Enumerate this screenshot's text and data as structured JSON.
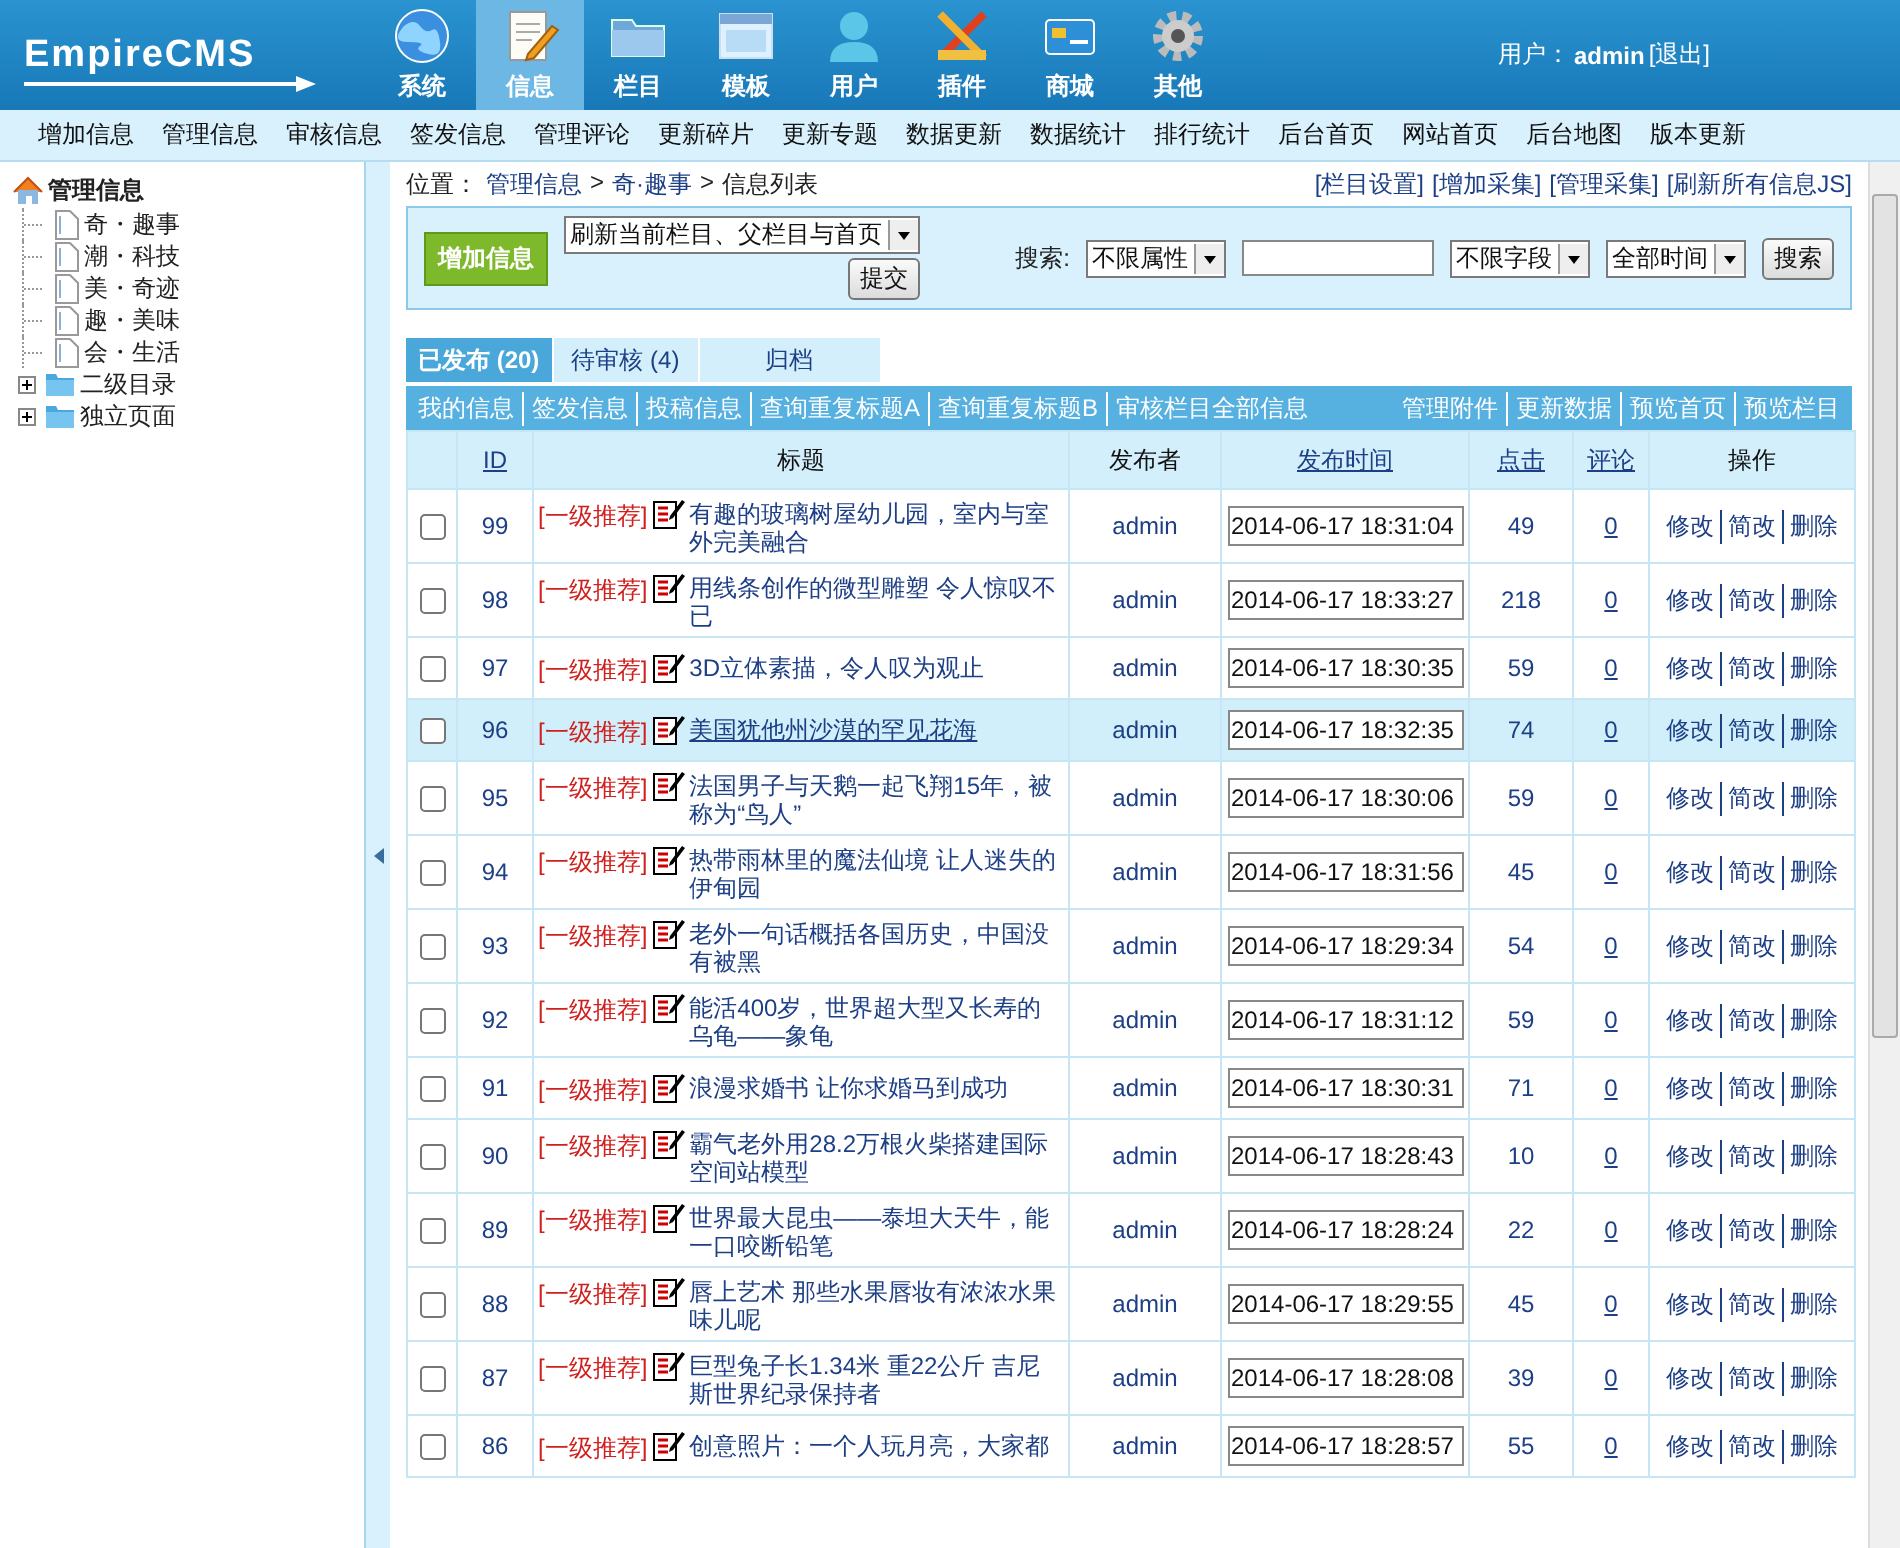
{
  "logo": {
    "text": "EmpireCMS"
  },
  "top_menu": [
    {
      "label": "系统",
      "selected": false
    },
    {
      "label": "信息",
      "selected": true
    },
    {
      "label": "栏目",
      "selected": false
    },
    {
      "label": "模板",
      "selected": false
    },
    {
      "label": "用户",
      "selected": false
    },
    {
      "label": "插件",
      "selected": false
    },
    {
      "label": "商城",
      "selected": false
    },
    {
      "label": "其他",
      "selected": false
    }
  ],
  "user": {
    "label": "用户：",
    "name": "admin",
    "logout": "[退出]"
  },
  "sub_menu": [
    "增加信息",
    "管理信息",
    "审核信息",
    "签发信息",
    "管理评论",
    "更新碎片",
    "更新专题",
    "数据更新",
    "数据统计",
    "排行统计",
    "后台首页",
    "网站首页",
    "后台地图",
    "版本更新"
  ],
  "tree": {
    "label": "管理信息",
    "children": [
      {
        "label": "奇・趣事",
        "kind": "page"
      },
      {
        "label": "潮・科技",
        "kind": "page"
      },
      {
        "label": "美・奇迹",
        "kind": "page"
      },
      {
        "label": "趣・美味",
        "kind": "page"
      },
      {
        "label": "会・生活",
        "kind": "page"
      },
      {
        "label": "二级目录",
        "kind": "folder",
        "expanded": false
      },
      {
        "label": "独立页面",
        "kind": "folder",
        "expanded": false
      }
    ]
  },
  "breadcrumb": {
    "label": "位置：",
    "separator": ">",
    "path": [
      "管理信息",
      "奇·趣事",
      "信息列表"
    ]
  },
  "quick_links": [
    "[栏目设置]",
    "[增加采集]",
    "[管理采集]",
    "[刷新所有信息JS]"
  ],
  "toolbar": {
    "add_button": "增加信息",
    "refresh_select": "刷新当前栏目、父栏目与首页",
    "submit_button": "提交",
    "search_label": "搜索:",
    "attribute_select": "不限属性",
    "field_select": "不限字段",
    "time_select": "全部时间",
    "search_button": "搜索"
  },
  "tabs": [
    {
      "label": "已发布 (20)",
      "selected": true
    },
    {
      "label": "待审核 (4)",
      "selected": false
    },
    {
      "label": "归档",
      "selected": false
    }
  ],
  "links_left": [
    "我的信息",
    "签发信息",
    "投稿信息",
    "查询重复标题A",
    "查询重复标题B",
    "审核栏目全部信息"
  ],
  "links_right": [
    "管理附件",
    "更新数据",
    "预览首页",
    "预览栏目"
  ],
  "table": {
    "columns": [
      {
        "label": "ID",
        "link": true
      },
      {
        "label": "标题",
        "link": false
      },
      {
        "label": "发布者",
        "link": false
      },
      {
        "label": "发布时间",
        "link": true
      },
      {
        "label": "点击",
        "link": true
      },
      {
        "label": "评论",
        "link": true
      },
      {
        "label": "操作",
        "link": false
      }
    ],
    "rows": [
      {
        "id": "99",
        "tag": "[一级推荐]",
        "title": "有趣的玻璃树屋幼儿园，室内与室外完美融合",
        "author": "admin",
        "time": "2014-06-17 18:31:04",
        "clicks": "49",
        "comments": "0",
        "actions": [
          "修改",
          "简改",
          "删除"
        ],
        "checked": false,
        "selected": false
      },
      {
        "id": "98",
        "tag": "[一级推荐]",
        "title": "用线条创作的微型雕塑 令人惊叹不已",
        "author": "admin",
        "time": "2014-06-17 18:33:27",
        "clicks": "218",
        "comments": "0",
        "actions": [
          "修改",
          "简改",
          "删除"
        ],
        "checked": false,
        "selected": false
      },
      {
        "id": "97",
        "tag": "[一级推荐]",
        "title": "3D立体素描，令人叹为观止",
        "author": "admin",
        "time": "2014-06-17 18:30:35",
        "clicks": "59",
        "comments": "0",
        "actions": [
          "修改",
          "简改",
          "删除"
        ],
        "checked": false,
        "selected": false
      },
      {
        "id": "96",
        "tag": "[一级推荐]",
        "title": "美国犹他州沙漠的罕见花海",
        "author": "admin",
        "time": "2014-06-17 18:32:35",
        "clicks": "74",
        "comments": "0",
        "actions": [
          "修改",
          "简改",
          "删除"
        ],
        "checked": false,
        "selected": true
      },
      {
        "id": "95",
        "tag": "[一级推荐]",
        "title": "法国男子与天鹅一起飞翔15年，被称为“鸟人”",
        "author": "admin",
        "time": "2014-06-17 18:30:06",
        "clicks": "59",
        "comments": "0",
        "actions": [
          "修改",
          "简改",
          "删除"
        ],
        "checked": false,
        "selected": false
      },
      {
        "id": "94",
        "tag": "[一级推荐]",
        "title": "热带雨林里的魔法仙境 让人迷失的伊甸园",
        "author": "admin",
        "time": "2014-06-17 18:31:56",
        "clicks": "45",
        "comments": "0",
        "actions": [
          "修改",
          "简改",
          "删除"
        ],
        "checked": false,
        "selected": false
      },
      {
        "id": "93",
        "tag": "[一级推荐]",
        "title": "老外一句话概括各国历史，中国没有被黑",
        "author": "admin",
        "time": "2014-06-17 18:29:34",
        "clicks": "54",
        "comments": "0",
        "actions": [
          "修改",
          "简改",
          "删除"
        ],
        "checked": false,
        "selected": false
      },
      {
        "id": "92",
        "tag": "[一级推荐]",
        "title": "能活400岁，世界超大型又长寿的乌龟——象龟",
        "author": "admin",
        "time": "2014-06-17 18:31:12",
        "clicks": "59",
        "comments": "0",
        "actions": [
          "修改",
          "简改",
          "删除"
        ],
        "checked": false,
        "selected": false
      },
      {
        "id": "91",
        "tag": "[一级推荐]",
        "title": "浪漫求婚书 让你求婚马到成功",
        "author": "admin",
        "time": "2014-06-17 18:30:31",
        "clicks": "71",
        "comments": "0",
        "actions": [
          "修改",
          "简改",
          "删除"
        ],
        "checked": false,
        "selected": false
      },
      {
        "id": "90",
        "tag": "[一级推荐]",
        "title": "霸气老外用28.2万根火柴搭建国际空间站模型",
        "author": "admin",
        "time": "2014-06-17 18:28:43",
        "clicks": "10",
        "comments": "0",
        "actions": [
          "修改",
          "简改",
          "删除"
        ],
        "checked": false,
        "selected": false
      },
      {
        "id": "89",
        "tag": "[一级推荐]",
        "title": "世界最大昆虫——泰坦大天牛，能一口咬断铅笔",
        "author": "admin",
        "time": "2014-06-17 18:28:24",
        "clicks": "22",
        "comments": "0",
        "actions": [
          "修改",
          "简改",
          "删除"
        ],
        "checked": false,
        "selected": false
      },
      {
        "id": "88",
        "tag": "[一级推荐]",
        "title": "唇上艺术 那些水果唇妆有浓浓水果味儿呢",
        "author": "admin",
        "time": "2014-06-17 18:29:55",
        "clicks": "45",
        "comments": "0",
        "actions": [
          "修改",
          "简改",
          "删除"
        ],
        "checked": false,
        "selected": false
      },
      {
        "id": "87",
        "tag": "[一级推荐]",
        "title": "巨型兔子长1.34米 重22公斤 吉尼斯世界纪录保持者",
        "author": "admin",
        "time": "2014-06-17 18:28:08",
        "clicks": "39",
        "comments": "0",
        "actions": [
          "修改",
          "简改",
          "删除"
        ],
        "checked": false,
        "selected": false
      },
      {
        "id": "86",
        "tag": "[一级推荐]",
        "title": "创意照片：一个人玩月亮，大家都",
        "author": "admin",
        "time": "2014-06-17 18:28:57",
        "clicks": "55",
        "comments": "0",
        "actions": [
          "修改",
          "简改",
          "删除"
        ],
        "checked": false,
        "selected": false
      }
    ]
  }
}
